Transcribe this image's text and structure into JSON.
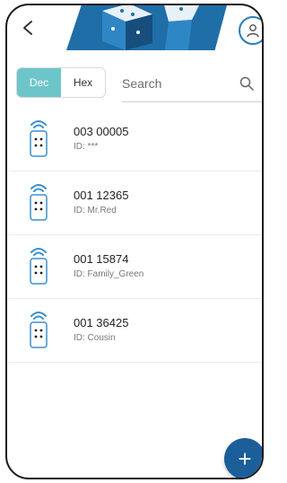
{
  "header": {
    "back_icon": "chevron-left-icon",
    "profile_icon": "user-icon",
    "brand_color": "#1f6ea8"
  },
  "toggle": {
    "options": [
      "Dec",
      "Hex"
    ],
    "selected": "Dec",
    "active_color": "#6cc6c9"
  },
  "search": {
    "placeholder": "Search",
    "value": "",
    "icon": "search-icon"
  },
  "devices": [
    {
      "code": "003 00005",
      "id": "ID: ***",
      "icon": "remote-control-icon"
    },
    {
      "code": "001 12365",
      "id": "ID: Mr.Red",
      "icon": "remote-control-icon"
    },
    {
      "code": "001 15874",
      "id": "ID: Family_Green",
      "icon": "remote-control-icon"
    },
    {
      "code": "001 36425",
      "id": "ID: Cousin",
      "icon": "remote-control-icon"
    }
  ],
  "fab": {
    "label": "+",
    "color": "#1b5e9a"
  }
}
